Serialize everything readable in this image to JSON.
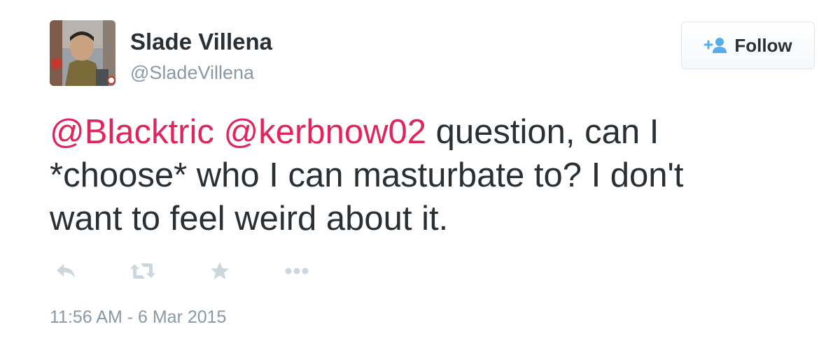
{
  "tweet": {
    "author": {
      "name": "Slade Villena",
      "handle": "@SladeVillena"
    },
    "follow_button": {
      "label": "Follow",
      "icon": "add-person-icon"
    },
    "text": {
      "mention1": "@Blacktric",
      "mention2": "@kerbnow02",
      "line1_rest": " question, can I",
      "line2": "*choose* who I can masturbate to? I don't",
      "line3": "want to feel weird about it."
    },
    "actions": [
      {
        "icon": "reply-icon"
      },
      {
        "icon": "retweet-icon"
      },
      {
        "icon": "favorite-star-icon"
      },
      {
        "icon": "more-dots-icon"
      }
    ],
    "timestamp": "11:56 AM - 6 Mar 2015"
  },
  "colors": {
    "text": "#292f33",
    "muted": "#8899a6",
    "mention": "#e0245e",
    "follow_icon": "#55acee",
    "action_icon": "#ccd6dd"
  }
}
